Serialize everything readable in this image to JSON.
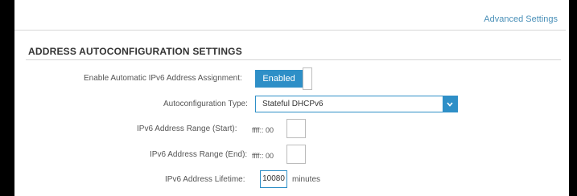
{
  "header": {
    "advanced_settings_link": "Advanced Settings"
  },
  "section": {
    "title": "ADDRESS AUTOCONFIGURATION SETTINGS"
  },
  "form": {
    "auto_assign": {
      "label": "Enable Automatic IPv6 Address Assignment:",
      "value": "Enabled"
    },
    "autoconfig_type": {
      "label": "Autoconfiguration Type:",
      "value": "Stateful DHCPv6"
    },
    "range_start": {
      "label": "IPv6 Address Range (Start):",
      "prefix": "ffff:: 00",
      "value": ""
    },
    "range_end": {
      "label": "IPv6 Address Range (End):",
      "prefix": "ffff:: 00",
      "value": ""
    },
    "lifetime": {
      "label": "IPv6 Address Lifetime:",
      "value": "10080",
      "unit": "minutes"
    }
  },
  "colors": {
    "accent": "#2e8fc7",
    "link": "#4a90b8",
    "frame": "#000000"
  },
  "icons": {
    "select_arrow": "chevron-down-icon"
  }
}
